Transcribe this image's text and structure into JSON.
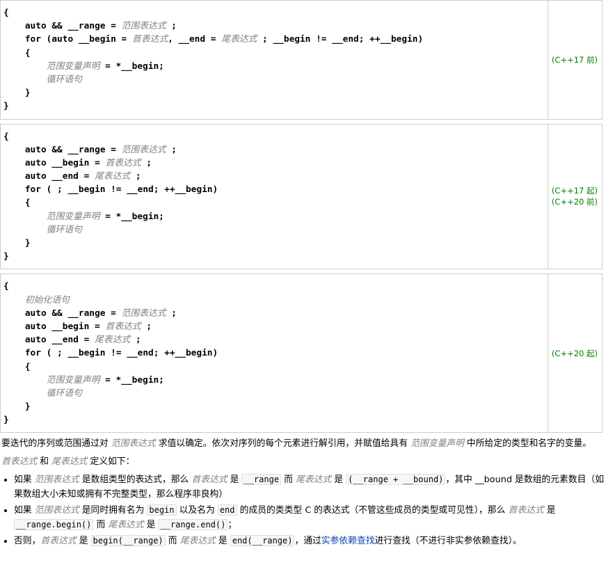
{
  "blocks": {
    "b1": {
      "label": "(C++17 前)",
      "l1a": "auto && __range = ",
      "l1p": "范围表达式",
      "l1b": " ;",
      "l2a": "for (auto __begin = ",
      "l2p1": "首表达式",
      "l2b": ", __end = ",
      "l2p2": "尾表达式",
      "l2c": " ; __begin != __end; ++__begin)",
      "l3p": "范围变量声明",
      "l3b": " = *__begin;",
      "l4p": "循环语句"
    },
    "b2": {
      "label1": "(C++17 起)",
      "label2": "(C++20 前)",
      "l1a": "auto && __range = ",
      "l1p": "范围表达式",
      "l1b": " ;",
      "l2a": "auto __begin = ",
      "l2p": "首表达式",
      "l2b": " ;",
      "l3a": "auto __end = ",
      "l3p": "尾表达式",
      "l3b": " ;",
      "l4a": "for ( ; __begin != __end; ++__begin)",
      "l5p": "范围变量声明",
      "l5b": " = *__begin;",
      "l6p": "循环语句"
    },
    "b3": {
      "label": "(C++20 起)",
      "l0p": "初始化语句",
      "l1a": "auto && __range = ",
      "l1p": "范围表达式",
      "l1b": " ;",
      "l2a": "auto __begin = ",
      "l2p": "首表达式",
      "l2b": " ;",
      "l3a": "auto __end = ",
      "l3p": "尾表达式",
      "l3b": " ;",
      "l4a": "for ( ; __begin != __end; ++__begin)",
      "l5p": "范围变量声明",
      "l5b": " = *__begin;",
      "l6p": "循环语句"
    }
  },
  "prose": {
    "p1a": "要迭代的序列或范围通过对 ",
    "p1t1": "范围表达式",
    "p1b": " 求值以确定。依次对序列的每个元素进行解引用，并赋值给具有 ",
    "p1t2": "范围变量声明",
    "p1c": " 中所给定的类型和名字的变量。",
    "p2a": "首表达式",
    "p2b": " 和 ",
    "p2c": "尾表达式",
    "p2d": " 定义如下：",
    "li1a": "如果 ",
    "li1t1": "范围表达式",
    "li1b": " 是数组类型的表达式，那么 ",
    "li1t2": "首表达式",
    "li1c": " 是 ",
    "li1code1": "__range",
    "li1d": " 而 ",
    "li1t3": "尾表达式",
    "li1e": " 是 ",
    "li1code2": "(__range + __bound)",
    "li1f": "，其中 __bound 是数组的元素数目（如果数组大小未知或拥有不完整类型，那么程序非良构）",
    "li2a": "如果 ",
    "li2t1": "范围表达式",
    "li2b": " 是同时拥有名为 ",
    "li2code1": "begin",
    "li2c": " 以及名为 ",
    "li2code2": "end",
    "li2d": " 的成员的类类型 C 的表达式（不管这些成员的类型或可见性），那么 ",
    "li2t2": "首表达式",
    "li2e": " 是 ",
    "li2code3": "__range.begin()",
    "li2f": " 而 ",
    "li2t3": "尾表达式",
    "li2g": " 是 ",
    "li2code4": "__range.end()",
    "li2h": "；",
    "li3a": "否则，",
    "li3t1": "首表达式",
    "li3b": " 是 ",
    "li3code1": "begin(__range)",
    "li3c": " 而 ",
    "li3t2": "尾表达式",
    "li3d": " 是 ",
    "li3code2": "end(__range)",
    "li3e": "，通过",
    "li3link": "实参依赖查找",
    "li3f": "进行查找（不进行非实参依赖查找）。"
  }
}
